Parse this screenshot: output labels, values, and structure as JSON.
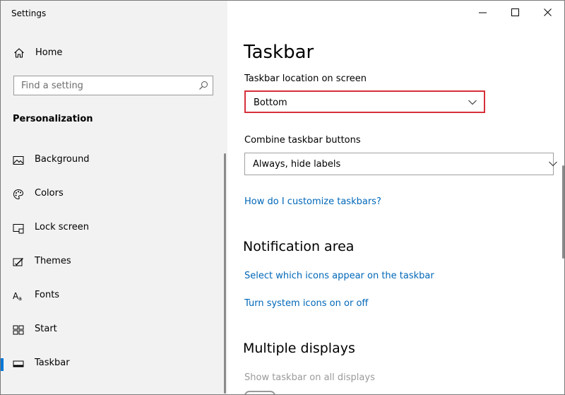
{
  "app": {
    "title": "Settings"
  },
  "sidebar": {
    "home_label": "Home",
    "search_placeholder": "Find a setting",
    "section_label": "Personalization",
    "items": [
      {
        "label": "Background",
        "icon": "image-icon"
      },
      {
        "label": "Colors",
        "icon": "palette-icon"
      },
      {
        "label": "Lock screen",
        "icon": "lock-screen-icon"
      },
      {
        "label": "Themes",
        "icon": "themes-icon"
      },
      {
        "label": "Fonts",
        "icon": "fonts-icon"
      },
      {
        "label": "Start",
        "icon": "start-icon"
      },
      {
        "label": "Taskbar",
        "icon": "taskbar-icon",
        "selected": true
      }
    ]
  },
  "main": {
    "title": "Taskbar",
    "location_label": "Taskbar location on screen",
    "location_value": "Bottom",
    "combine_label": "Combine taskbar buttons",
    "combine_value": "Always, hide labels",
    "customize_link": "How do I customize taskbars?",
    "notification_title": "Notification area",
    "notification_link1": "Select which icons appear on the taskbar",
    "notification_link2": "Turn system icons on or off",
    "multiple_title": "Multiple displays",
    "show_all_label": "Show taskbar on all displays"
  },
  "colors": {
    "accent": "#0078d7",
    "link": "#0067b8",
    "highlight_border": "#d7303a",
    "sidebar_bg": "#f2f2f2"
  }
}
